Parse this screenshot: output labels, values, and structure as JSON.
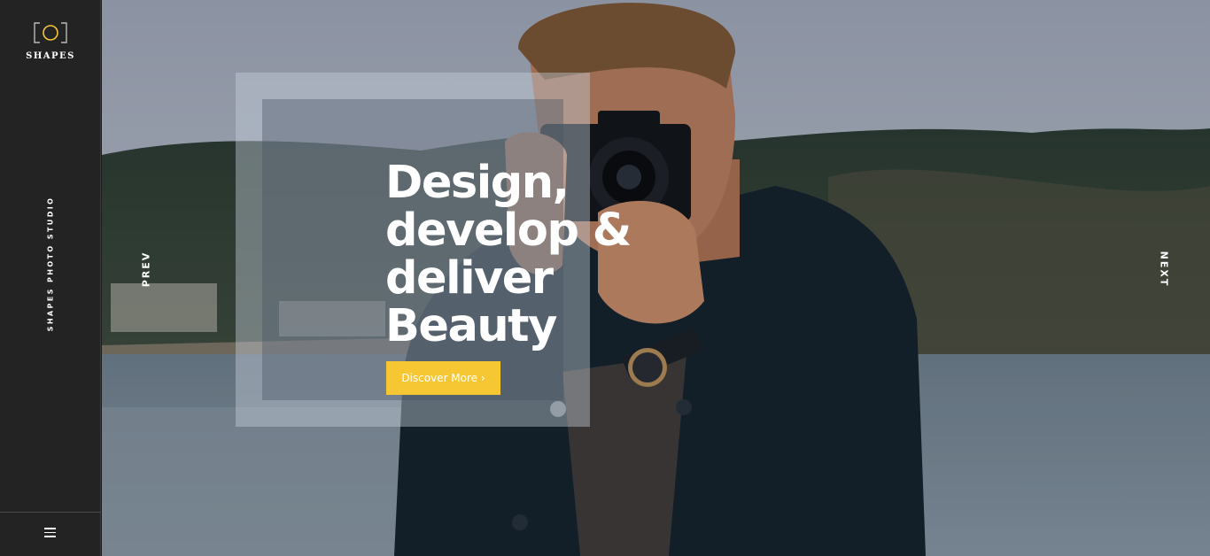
{
  "brand": {
    "name": "SHAPES",
    "tagline": "SHAPES PHOTO STUDIO",
    "logo_icon": "camera-frame-icon",
    "accent_color": "#f7c733"
  },
  "menu": {
    "icon": "hamburger-menu-icon"
  },
  "hero": {
    "headline_lines": [
      "Design,",
      "develop &",
      "deliver",
      "Beauty"
    ],
    "cta_label": "Discover More ›",
    "prev_label": "PREV",
    "next_label": "NEXT",
    "image": "man-holding-sony-camera-photo"
  }
}
